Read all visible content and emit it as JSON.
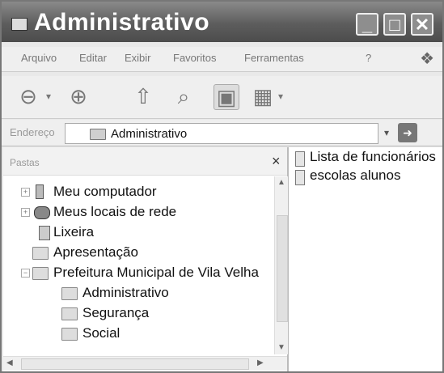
{
  "window": {
    "title": "Administrativo",
    "min": "_",
    "max": "□",
    "close": "✕"
  },
  "menu": {
    "items": [
      "Arquivo",
      "Editar",
      "Exibir",
      "Favoritos",
      "Ferramentas",
      "?"
    ]
  },
  "address": {
    "label": "Endereço",
    "value": "Administrativo"
  },
  "folders_pane": {
    "title": "Pastas",
    "close": "×",
    "items": [
      {
        "label": "Meu computador",
        "icon": "computer-icon"
      },
      {
        "label": "Meus locais de rede",
        "icon": "network-icon"
      },
      {
        "label": "Lixeira",
        "icon": "recycle-bin-icon"
      },
      {
        "label": "Apresentação",
        "icon": "folder-icon"
      },
      {
        "label": "Prefeitura Municipal de Vila Velha",
        "icon": "folder-icon",
        "expanded": true
      },
      {
        "label": "Administrativo",
        "icon": "folder-icon",
        "selected": true
      },
      {
        "label": "Segurança",
        "icon": "folder-icon"
      },
      {
        "label": "Social",
        "icon": "folder-icon"
      }
    ]
  },
  "files": [
    {
      "label": "Lista de funcionários",
      "icon": "document-icon"
    },
    {
      "label": "escolas alunos",
      "icon": "document-icon"
    }
  ],
  "colors": {
    "titlebar": "#5d5d5d",
    "pane_bg": "#ffffff",
    "chrome": "#efefef"
  }
}
